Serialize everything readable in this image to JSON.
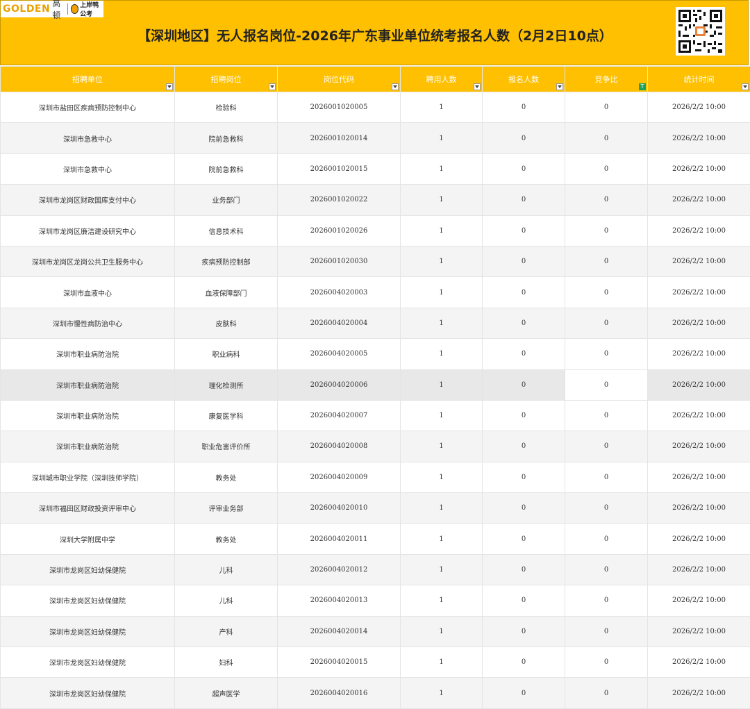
{
  "header": {
    "logo_golden": "GOLDEN",
    "logo_cn": "高顿",
    "logo_sub": "上岸鸭公考",
    "title": "【深圳地区】无人报名岗位-2026年广东事业单位统考报名人数（2月2日10点）"
  },
  "columns": [
    "招聘单位",
    "招聘岗位",
    "岗位代码",
    "聘用人数",
    "报名人数",
    "竞争比",
    "统计时间"
  ],
  "rows": [
    [
      "深圳市盐田区疾病预防控制中心",
      "检验科",
      "2026001020005",
      "1",
      "0",
      "0",
      "2026/2/2 10:00"
    ],
    [
      "深圳市急救中心",
      "院前急救科",
      "2026001020014",
      "1",
      "0",
      "0",
      "2026/2/2 10:00"
    ],
    [
      "深圳市急救中心",
      "院前急救科",
      "2026001020015",
      "1",
      "0",
      "0",
      "2026/2/2 10:00"
    ],
    [
      "深圳市龙岗区财政国库支付中心",
      "业务部门",
      "2026001020022",
      "1",
      "0",
      "0",
      "2026/2/2 10:00"
    ],
    [
      "深圳市龙岗区廉洁建设研究中心",
      "信息技术科",
      "2026001020026",
      "1",
      "0",
      "0",
      "2026/2/2 10:00"
    ],
    [
      "深圳市龙岗区龙岗公共卫生服务中心",
      "疾病预防控制部",
      "2026001020030",
      "1",
      "0",
      "0",
      "2026/2/2 10:00"
    ],
    [
      "深圳市血液中心",
      "血液保障部门",
      "2026004020003",
      "1",
      "0",
      "0",
      "2026/2/2 10:00"
    ],
    [
      "深圳市慢性病防治中心",
      "皮肤科",
      "2026004020004",
      "1",
      "0",
      "0",
      "2026/2/2 10:00"
    ],
    [
      "深圳市职业病防治院",
      "职业病科",
      "2026004020005",
      "1",
      "0",
      "0",
      "2026/2/2 10:00"
    ],
    [
      "深圳市职业病防治院",
      "理化检测所",
      "2026004020006",
      "1",
      "0",
      "0",
      "2026/2/2 10:00"
    ],
    [
      "深圳市职业病防治院",
      "康复医学科",
      "2026004020007",
      "1",
      "0",
      "0",
      "2026/2/2 10:00"
    ],
    [
      "深圳市职业病防治院",
      "职业危害评价所",
      "2026004020008",
      "1",
      "0",
      "0",
      "2026/2/2 10:00"
    ],
    [
      "深圳城市职业学院（深圳技师学院）",
      "教务处",
      "2026004020009",
      "1",
      "0",
      "0",
      "2026/2/2 10:00"
    ],
    [
      "深圳市福田区财政投资评审中心",
      "评审业务部",
      "2026004020010",
      "1",
      "0",
      "0",
      "2026/2/2 10:00"
    ],
    [
      "深圳大学附属中学",
      "教务处",
      "2026004020011",
      "1",
      "0",
      "0",
      "2026/2/2 10:00"
    ],
    [
      "深圳市龙岗区妇幼保健院",
      "儿科",
      "2026004020012",
      "1",
      "0",
      "0",
      "2026/2/2 10:00"
    ],
    [
      "深圳市龙岗区妇幼保健院",
      "儿科",
      "2026004020013",
      "1",
      "0",
      "0",
      "2026/2/2 10:00"
    ],
    [
      "深圳市龙岗区妇幼保健院",
      "产科",
      "2026004020014",
      "1",
      "0",
      "0",
      "2026/2/2 10:00"
    ],
    [
      "深圳市龙岗区妇幼保健院",
      "妇科",
      "2026004020015",
      "1",
      "0",
      "0",
      "2026/2/2 10:00"
    ],
    [
      "深圳市龙岗区妇幼保健院",
      "超声医学",
      "2026004020016",
      "1",
      "0",
      "0",
      "2026/2/2 10:00"
    ]
  ],
  "colors": {
    "header_bg": "#fec000",
    "filter_active": "#1aa260"
  },
  "icons": {
    "dropdown": "dropdown-arrow-icon",
    "filter": "filter-active-icon",
    "qr": "qr-code-icon"
  }
}
